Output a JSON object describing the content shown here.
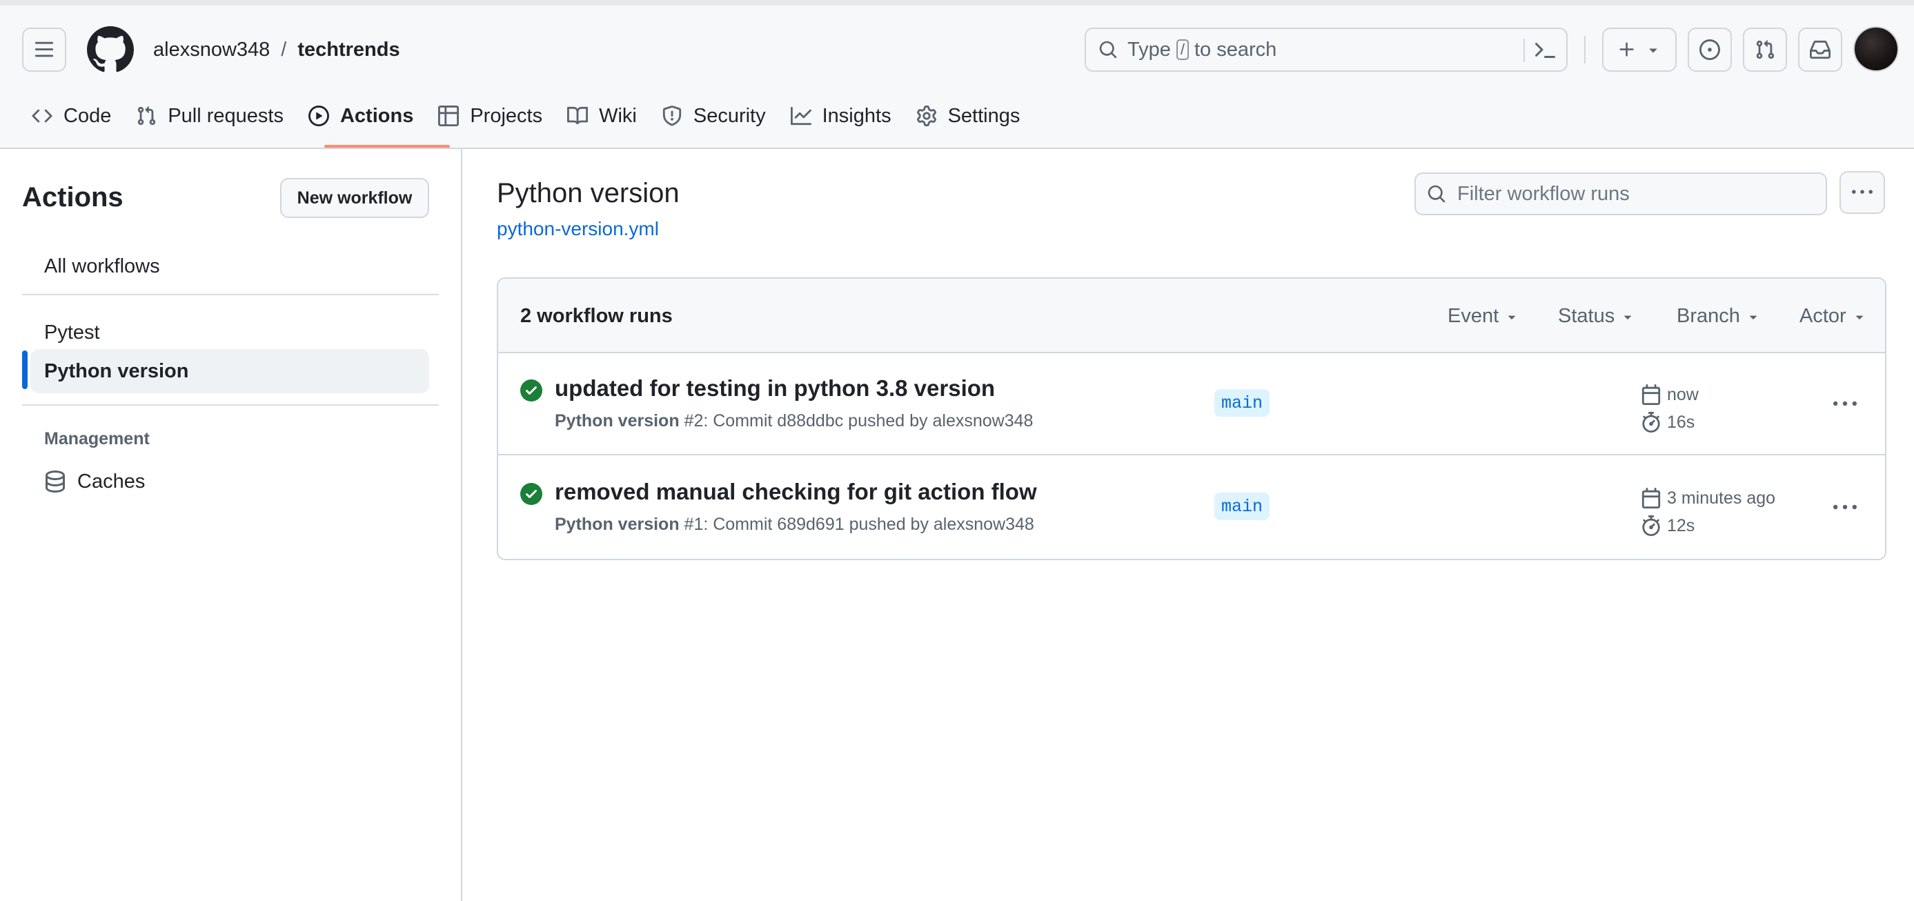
{
  "header": {
    "owner": "alexsnow348",
    "separator": "/",
    "repo": "techtrends",
    "search_prefix": "Type",
    "search_key": "/",
    "search_suffix": "to search"
  },
  "nav": {
    "tabs": [
      {
        "label": "Code",
        "icon": "code-icon"
      },
      {
        "label": "Pull requests",
        "icon": "git-pull-request-icon"
      },
      {
        "label": "Actions",
        "icon": "play-icon",
        "active": true
      },
      {
        "label": "Projects",
        "icon": "table-icon"
      },
      {
        "label": "Wiki",
        "icon": "book-icon"
      },
      {
        "label": "Security",
        "icon": "shield-icon"
      },
      {
        "label": "Insights",
        "icon": "graph-icon"
      },
      {
        "label": "Settings",
        "icon": "gear-icon"
      }
    ]
  },
  "sidebar": {
    "title": "Actions",
    "new_workflow_label": "New workflow",
    "all_workflows": "All workflows",
    "workflows": [
      "Pytest",
      "Python version"
    ],
    "selected_workflow": "Python version",
    "management_heading": "Management",
    "caches_label": "Caches"
  },
  "main": {
    "title": "Python version",
    "file_link": "python-version.yml",
    "filter_placeholder": "Filter workflow runs",
    "runs_count": "2 workflow runs",
    "filters": [
      "Event",
      "Status",
      "Branch",
      "Actor"
    ],
    "runs": [
      {
        "title": "updated for testing in python 3.8 version",
        "workflow": "Python version",
        "detail": "#2: Commit d88ddbc pushed by alexsnow348",
        "branch": "main",
        "when": "now",
        "duration": "16s",
        "status": "success"
      },
      {
        "title": "removed manual checking for git action flow",
        "workflow": "Python version",
        "detail": "#1: Commit 689d691 pushed by alexsnow348",
        "branch": "main",
        "when": "3 minutes ago",
        "duration": "12s",
        "status": "success"
      }
    ]
  },
  "colors": {
    "accent": "#0969da",
    "success": "#1a7f37",
    "active_tab_underline": "#fd8c73",
    "border": "#d0d7de",
    "header_bg": "#f6f8fa"
  }
}
